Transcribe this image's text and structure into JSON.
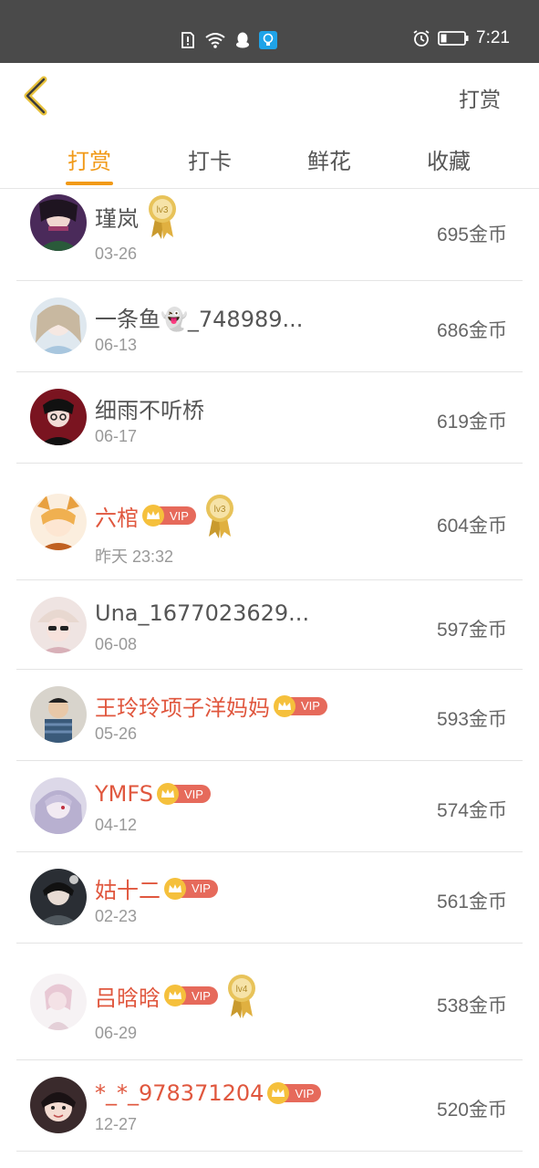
{
  "status_bar": {
    "time": "7:21",
    "icons": [
      "sim-alert-icon",
      "wifi-icon",
      "qq-icon",
      "lightbulb-app-icon",
      "alarm-icon",
      "battery-icon"
    ]
  },
  "nav": {
    "back_icon": "chevron-left-icon",
    "action_label": "打赏"
  },
  "tabs": [
    {
      "label": "打赏",
      "active": true
    },
    {
      "label": "打卡",
      "active": false
    },
    {
      "label": "鲜花",
      "active": false
    },
    {
      "label": "收藏",
      "active": false
    }
  ],
  "colors": {
    "accent": "#f19a18",
    "vip_name": "#e0573e",
    "vip_badge": "#e66a5b",
    "status_bar": "#4a4a4a"
  },
  "entries": [
    {
      "name": "瑾岚",
      "date": "03-26",
      "amount": "695金币",
      "vip": false,
      "level": "lv3",
      "vip_label": ""
    },
    {
      "name": "一条鱼👻_748989...",
      "date": "06-13",
      "amount": "686金币",
      "vip": false,
      "level": "",
      "vip_label": ""
    },
    {
      "name": "细雨不听桥",
      "date": "06-17",
      "amount": "619金币",
      "vip": false,
      "level": "",
      "vip_label": ""
    },
    {
      "name": "六棺",
      "date": "昨天 23:32",
      "amount": "604金币",
      "vip": true,
      "level": "lv3",
      "vip_label": "VIP"
    },
    {
      "name": "Una_1677023629...",
      "date": "06-08",
      "amount": "597金币",
      "vip": false,
      "level": "",
      "vip_label": ""
    },
    {
      "name": "王玲玲项子洋妈妈",
      "date": "05-26",
      "amount": "593金币",
      "vip": true,
      "level": "",
      "vip_label": "VIP"
    },
    {
      "name": "YMFS",
      "date": "04-12",
      "amount": "574金币",
      "vip": true,
      "level": "",
      "vip_label": "VIP"
    },
    {
      "name": "姑十二",
      "date": "02-23",
      "amount": "561金币",
      "vip": true,
      "level": "",
      "vip_label": "VIP"
    },
    {
      "name": "吕晗晗",
      "date": "06-29",
      "amount": "538金币",
      "vip": true,
      "level": "lv4",
      "vip_label": "VIP"
    },
    {
      "name": "*_*_978371204",
      "date": "12-27",
      "amount": "520金币",
      "vip": true,
      "level": "",
      "vip_label": "VIP"
    }
  ]
}
